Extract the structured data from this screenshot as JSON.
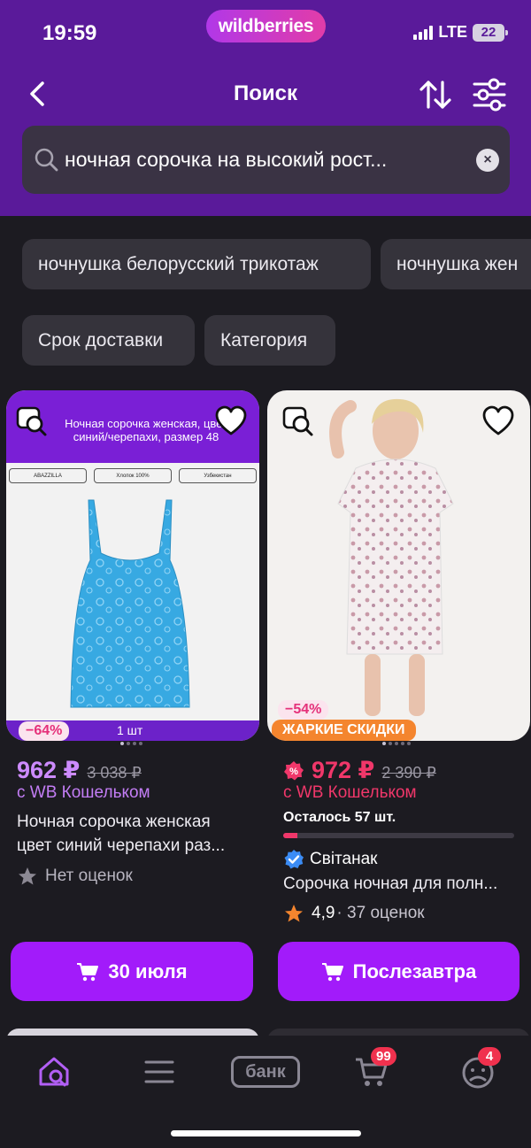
{
  "status_bar": {
    "time": "19:59",
    "network": "LTE",
    "battery": "22"
  },
  "brand": {
    "logo_text": "wildberries",
    "accent": "#a21bfa",
    "header_color": "#5a1a9a"
  },
  "header": {
    "title": "Поиск"
  },
  "search": {
    "value": "ночная сорочка на высокий рост...",
    "clear_icon": "×"
  },
  "suggestions": [
    "ночнушка белорусский трикотаж",
    "ночнушка жен"
  ],
  "filters": [
    "Срок доставки",
    "Категория"
  ],
  "products": [
    {
      "image_caption_line1": "Ночная сорочка женская, цвет",
      "image_caption_line2": "синий/черепахи, размер 48",
      "image_tags": [
        "ABAZZILLA",
        "Хлопок 100%",
        "Узбекистан"
      ],
      "image_quantity": "1 шт",
      "discount": "−64%",
      "price": "962 ₽",
      "old_price": "3 038 ₽",
      "wallet_label": "с WB Кошельком",
      "title_line1": "Ночная сорочка женская",
      "title_line2": "цвет синий черепахи раз...",
      "rating_text": "Нет оценок",
      "button_label": "30 июля"
    },
    {
      "discount": "−54%",
      "promo_label": "ЖАРКИЕ СКИДКИ",
      "price": "972 ₽",
      "old_price": "2 390 ₽",
      "wallet_label": "с WB Кошельком",
      "stock_label": "Осталось 57 шт.",
      "stock_fraction": 0.06,
      "brand": "Світанак",
      "title_line1": "Сорочка ночная для полн...",
      "rating": "4,9",
      "reviews": "· 37 оценок",
      "button_label": "Послезавтра"
    }
  ],
  "bottom_nav": {
    "bank_label": "банк",
    "cart_count": "99",
    "profile_count": "4",
    "icons": [
      "home-search-icon",
      "catalog-icon",
      "bank-icon",
      "cart-icon",
      "profile-icon"
    ]
  }
}
